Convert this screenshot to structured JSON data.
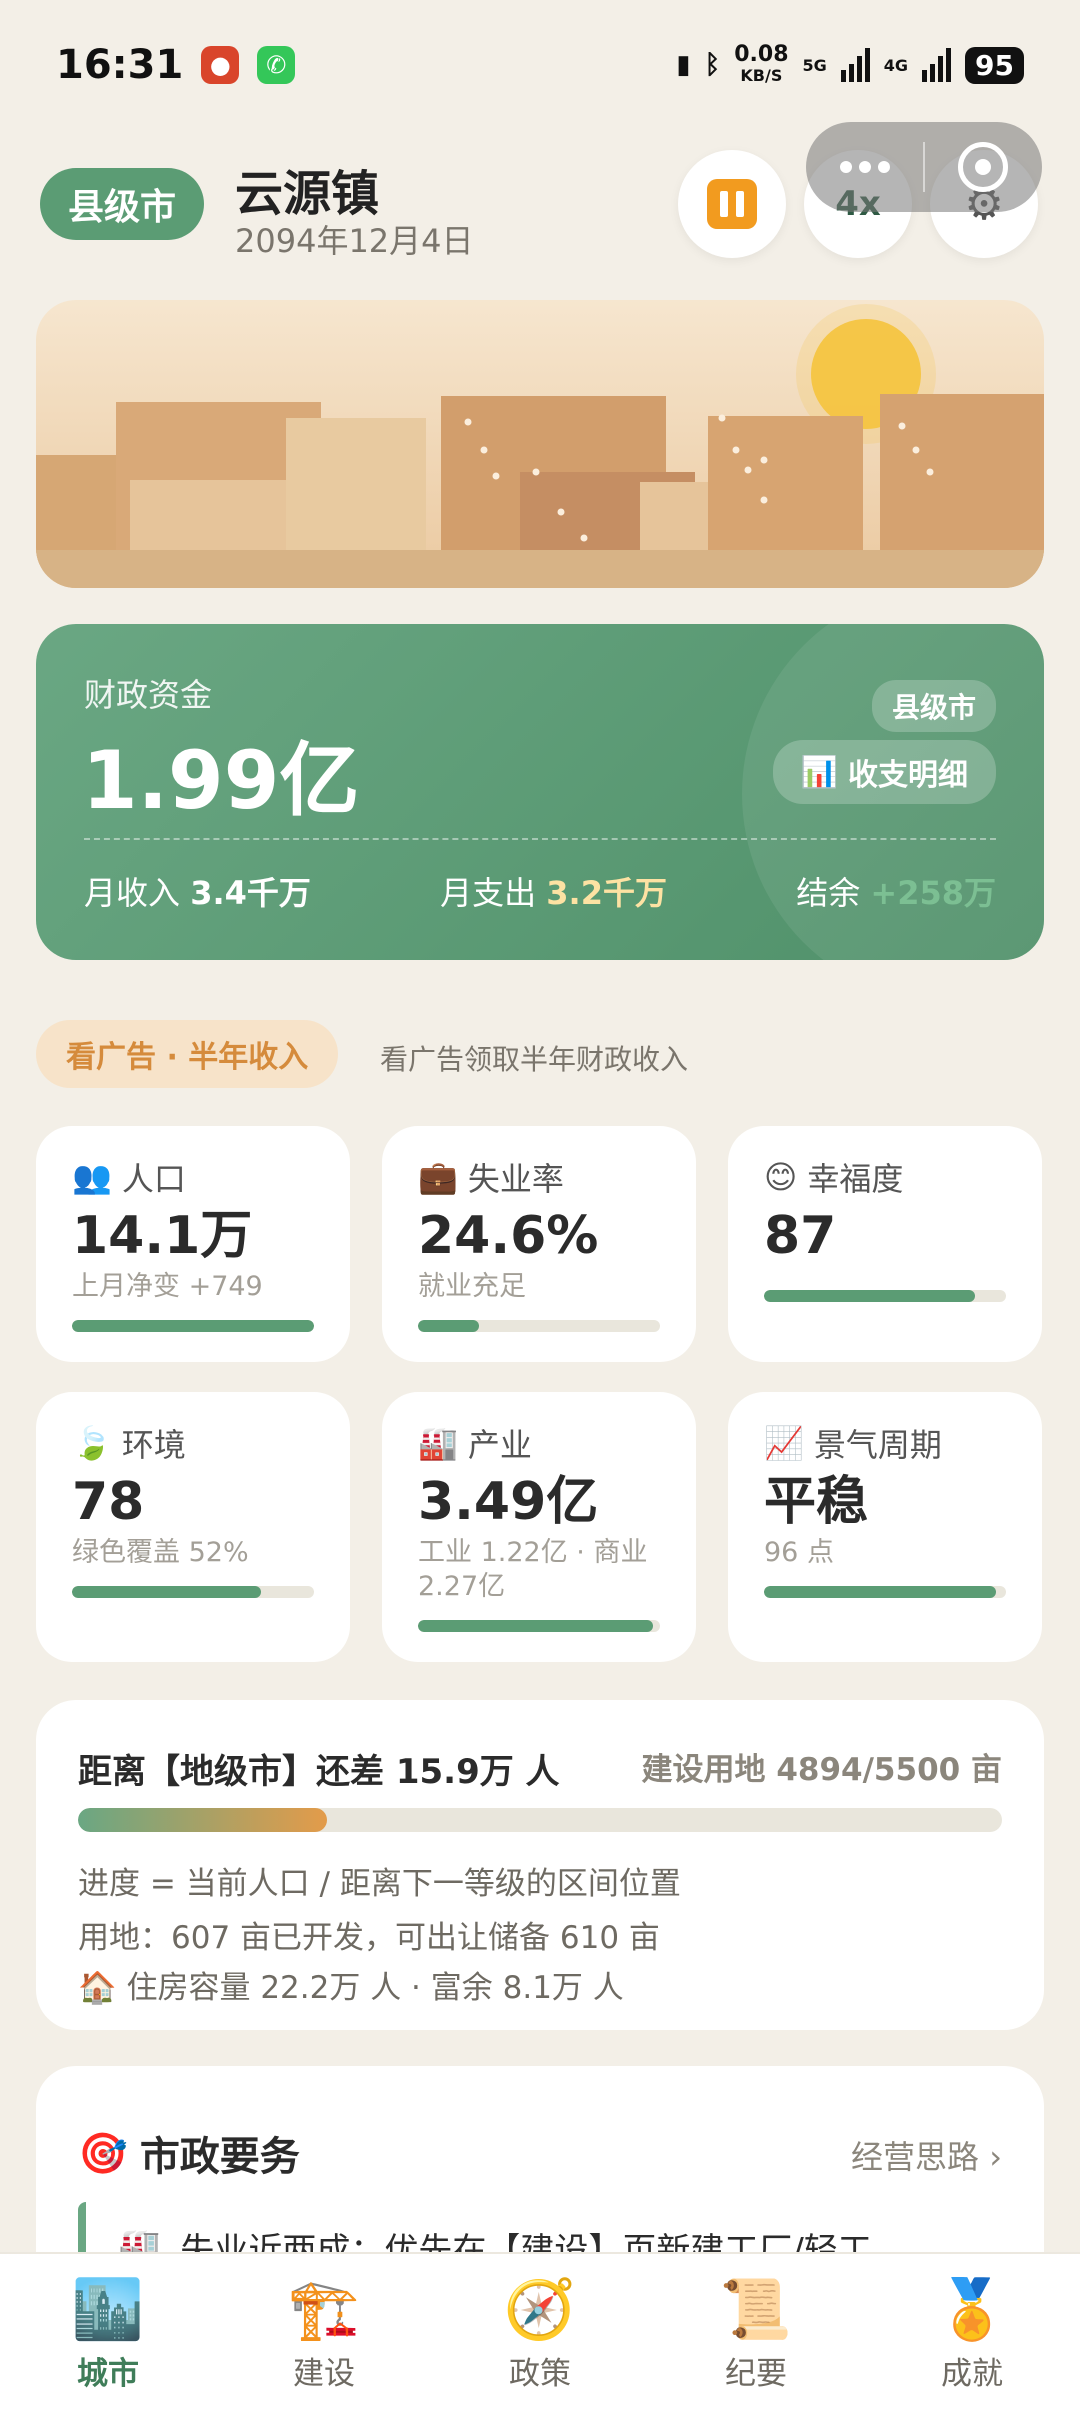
{
  "status_bar": {
    "time": "16:31",
    "net_speed_value": "0.08",
    "net_speed_unit": "KB/S",
    "signal1_label": "5G",
    "signal2_label": "4G",
    "battery": "95"
  },
  "header": {
    "tier_badge": "县级市",
    "town_name": "云源镇",
    "date": "2094年12月4日",
    "speed_label": "4x"
  },
  "finance": {
    "label": "财政资金",
    "amount": "1.99亿",
    "tier_tag": "县级市",
    "detail_button": "收支明细",
    "income_label": "月收入",
    "income_value": "3.4千万",
    "expense_label": "月支出",
    "expense_value": "3.2千万",
    "balance_label": "结余",
    "balance_value": "+258万"
  },
  "ad": {
    "button": "看广告 · 半年收入",
    "hint": "看广告领取半年财政收入"
  },
  "stats": [
    {
      "icon": "people-icon",
      "glyph": "👥",
      "label": "人口",
      "value": "14.1万",
      "sub": "上月净变 +749",
      "progress": 1.0
    },
    {
      "icon": "briefcase-icon",
      "glyph": "💼",
      "label": "失业率",
      "value": "24.6%",
      "sub": "就业充足",
      "progress": 0.25
    },
    {
      "icon": "smile-icon",
      "glyph": "😊",
      "label": "幸福度",
      "value": "87",
      "sub": "",
      "progress": 0.87
    },
    {
      "icon": "leaf-icon",
      "glyph": "🍃",
      "label": "环境",
      "value": "78",
      "sub": "绿色覆盖 52%",
      "progress": 0.78
    },
    {
      "icon": "factory-icon",
      "glyph": "🏭",
      "label": "产业",
      "value": "3.49亿",
      "sub": "工业 1.22亿 · 商业 2.27亿",
      "progress": 0.97
    },
    {
      "icon": "trend-chart-icon",
      "glyph": "📈",
      "label": "景气周期",
      "value": "平稳",
      "sub": "96 点",
      "progress": 0.96
    }
  ],
  "progress_card": {
    "title": "距离【地级市】还差 15.9万 人",
    "land": "建设用地 4894/5500 亩",
    "progress": 0.27,
    "line1": "进度 = 当前人口 / 距离下一等级的区间位置",
    "line2": "用地：607 亩已开发，可出让储备 610 亩",
    "line3": "住房容量 22.2万 人 · 富余 8.1万 人"
  },
  "tasks": {
    "title": "市政要务",
    "link": "经营思路 ›",
    "item1": "失业近两成：优先在【建设】页新建工厂/轻工"
  },
  "bottom_nav": [
    {
      "label": "城市",
      "icon": "city-icon",
      "glyph": "🏙️",
      "active": true
    },
    {
      "label": "建设",
      "icon": "crane-icon",
      "glyph": "🏗️",
      "active": false
    },
    {
      "label": "政策",
      "icon": "compass-icon",
      "glyph": "🧭",
      "active": false
    },
    {
      "label": "纪要",
      "icon": "scroll-icon",
      "glyph": "📜",
      "active": false
    },
    {
      "label": "成就",
      "icon": "medal-icon",
      "glyph": "🏅",
      "active": false
    }
  ]
}
